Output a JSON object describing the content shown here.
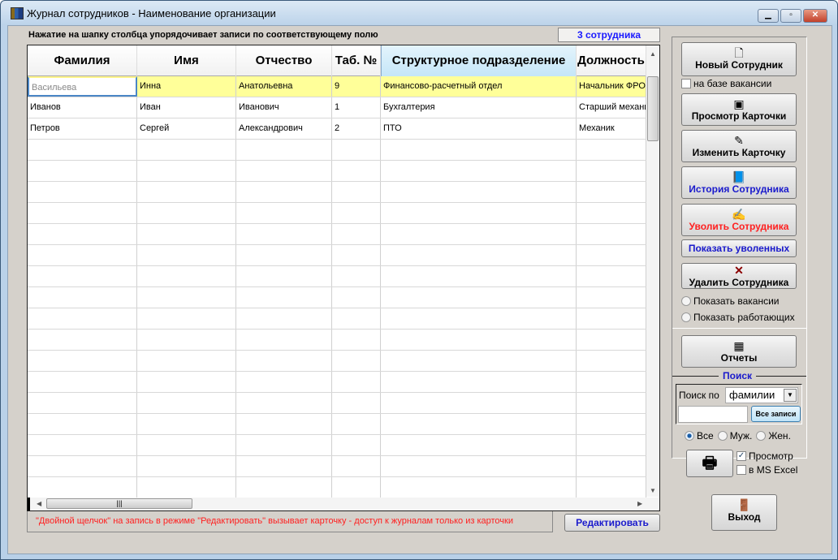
{
  "window": {
    "title": "Журнал сотрудников -  Наименование организации"
  },
  "hint": "Нажатие на шапку столбца упорядочивает записи  по соответствующему полю",
  "count": "3 сотрудника",
  "table": {
    "columns": [
      "Фамилия",
      "Имя",
      "Отчество",
      "Таб. №",
      "Структурное подразделение",
      "Должность"
    ],
    "sorted_column": "Структурное подразделение",
    "rows": [
      [
        "Васильева",
        "Инна",
        "Анатольевна",
        "9",
        "Финансово-расчетный отдел",
        "Начальник ФРО"
      ],
      [
        "Иванов",
        "Иван",
        "Иванович",
        "1",
        "Бухгалтерия",
        "Старший механик"
      ],
      [
        "Петров",
        "Сергей",
        "Александрович",
        "2",
        "ПТО",
        "Механик"
      ]
    ],
    "selected_row": 0
  },
  "footer_note": "\"Двойной щелчок\" на запись в режиме \"Редактировать\" вызывает карточку  -  доступ к журналам только из карточки",
  "edit_button": "Редактировать",
  "side": {
    "new_employee": "Новый Сотрудник",
    "vacancy_based": "на базе вакансии",
    "view_card": "Просмотр Карточки",
    "edit_card": "Изменить Карточку",
    "history": "История Сотрудника",
    "dismiss": "Уволить Сотрудника",
    "show_dismissed": "Показать уволенных",
    "delete": "Удалить Сотрудника",
    "show_vacancies": "Показать вакансии",
    "show_working": "Показать работающих",
    "reports": "Отчеты",
    "search_title": "Поиск",
    "search_by_label": "Поиск по",
    "search_by_value": "фамилии",
    "search_value": "",
    "all_records": "Все записи",
    "gender": [
      "Все",
      "Муж.",
      "Жен."
    ],
    "gender_selected": "Все",
    "preview": "Просмотр",
    "preview_checked": true,
    "excel": "в MS Excel",
    "excel_checked": false,
    "exit": "Выход"
  },
  "colors": {
    "selected_row": "#ffff99",
    "link_blue": "#1a1acc",
    "danger_red": "#ff2020"
  }
}
